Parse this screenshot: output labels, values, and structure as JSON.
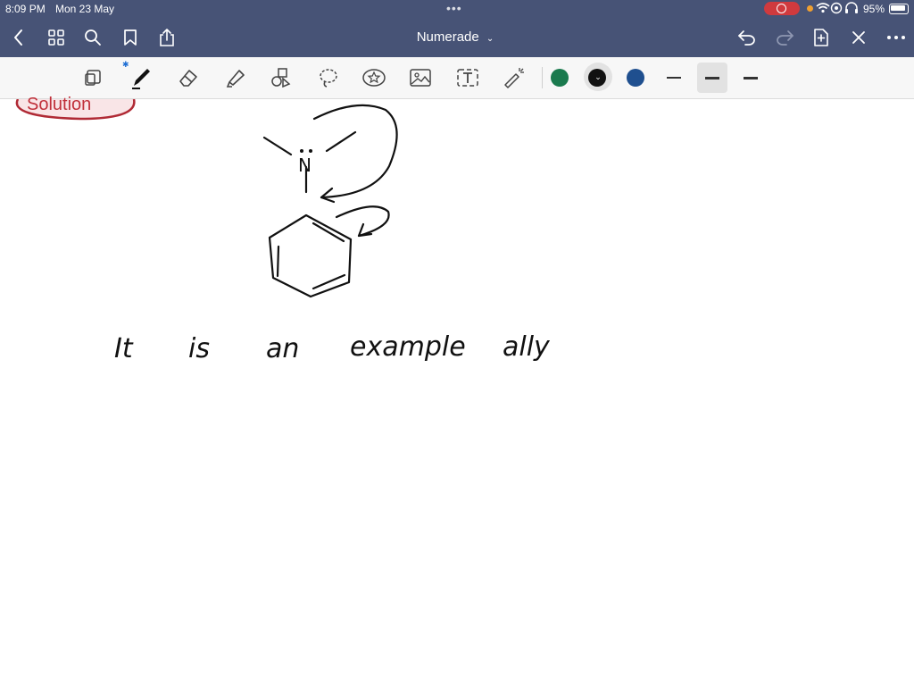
{
  "status_bar": {
    "time": "8:09 PM",
    "date": "Mon 23 May",
    "battery": "95%"
  },
  "nav": {
    "title": "Numerade",
    "left_icons": [
      "back-icon",
      "grid-icon",
      "search-icon",
      "bookmark-icon",
      "share-icon"
    ],
    "right_icons": [
      "undo-icon",
      "redo-icon",
      "add-page-icon",
      "close-icon",
      "more-icon"
    ]
  },
  "toolbar": {
    "tools": [
      "page-view-icon",
      "pen-icon",
      "eraser-icon",
      "highlighter-icon",
      "shapes-icon",
      "lasso-icon",
      "sticker-icon",
      "image-icon",
      "text-icon",
      "laser-pointer-icon"
    ],
    "colors": [
      "#1a7a4e",
      "#111111",
      "#1f4f8f"
    ],
    "selected_color": "#111111",
    "stroke_widths": [
      "thin",
      "medium",
      "thick"
    ],
    "selected_stroke": "medium"
  },
  "canvas": {
    "badge_label": "Solution",
    "atom_label": "N",
    "handwriting": [
      "It",
      "is",
      "an",
      "example",
      "ally"
    ]
  }
}
